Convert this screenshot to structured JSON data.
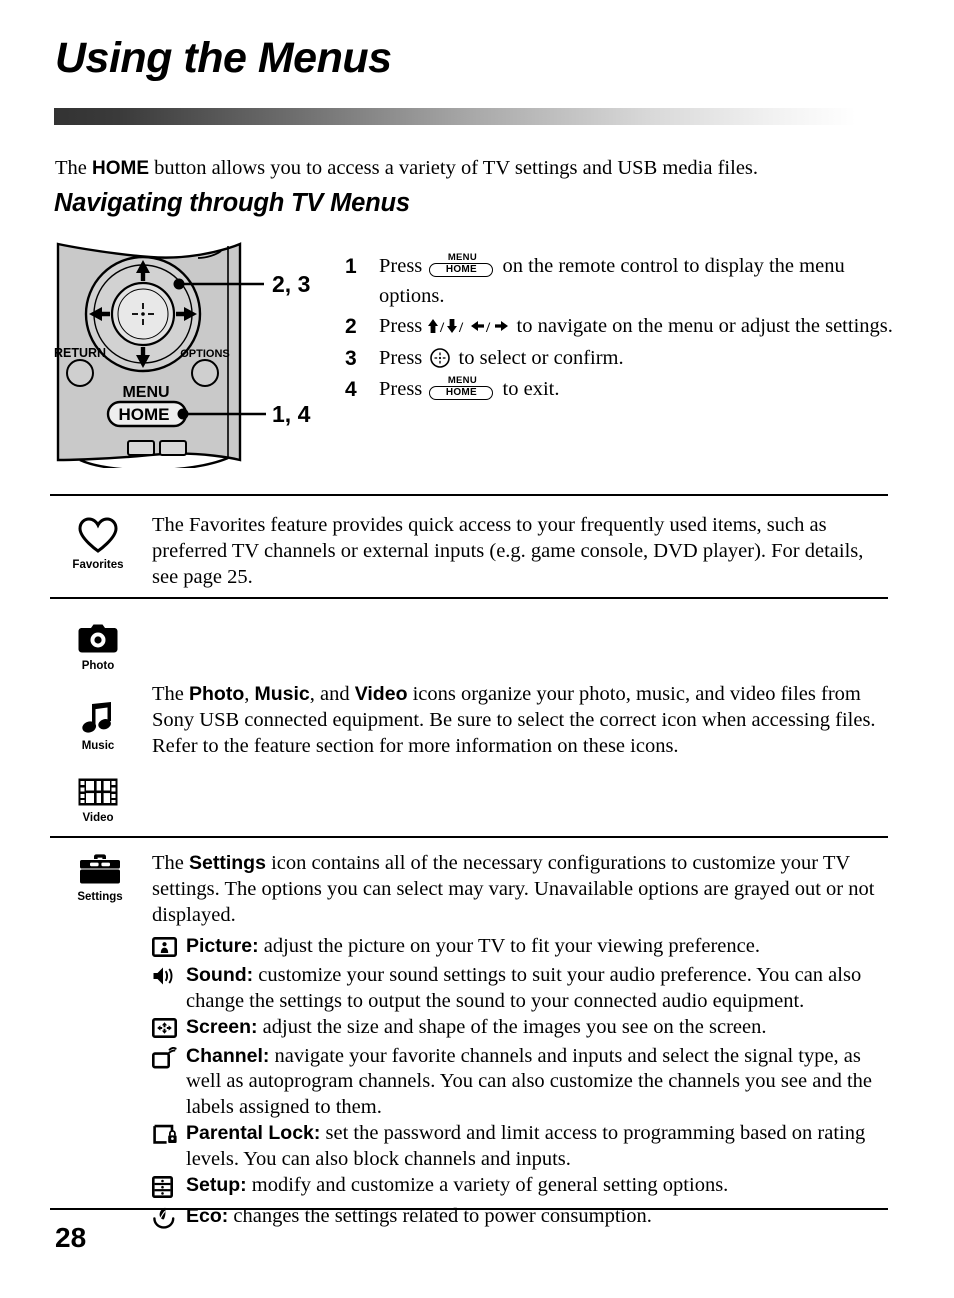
{
  "document": {
    "title": "Using the Menus",
    "page_number": "28",
    "intro_prefix": "The ",
    "intro_bold": "HOME",
    "intro_suffix": " button allows you to access a variety of TV settings and USB media files.",
    "section_title": "Navigating through TV Menus"
  },
  "remote": {
    "label_return": "RETURN",
    "label_options": "OPTIONS",
    "label_menu": "MENU",
    "label_home": "HOME",
    "callout_upper": "2, 3",
    "callout_lower": "1, 4"
  },
  "steps": [
    {
      "num": "1",
      "before": "Press ",
      "key": {
        "top": "MENU",
        "bottom": "HOME"
      },
      "after": " on the remote control to display the menu options."
    },
    {
      "num": "2",
      "before": "Press ",
      "arrows": "⬆/⬇/⬅/➡",
      "after": " to navigate on the menu or adjust the settings."
    },
    {
      "num": "3",
      "before": "Press ",
      "key_confirm": "confirm-button-icon",
      "after": " to select or confirm."
    },
    {
      "num": "4",
      "before": "Press ",
      "key": {
        "top": "MENU",
        "bottom": "HOME"
      },
      "after": " to exit."
    }
  ],
  "blocks": {
    "favorites": {
      "icon_label": "Favorites",
      "icon_name": "heart-icon",
      "text": "The Favorites feature provides quick access to your frequently used items, such as preferred TV channels or external inputs (e.g. game console, DVD player). For details, see page 25."
    },
    "media": {
      "icons": [
        {
          "label": "Photo",
          "icon_name": "camera-icon"
        },
        {
          "label": "Music",
          "icon_name": "music-note-icon"
        },
        {
          "label": "Video",
          "icon_name": "film-strip-icon"
        }
      ],
      "text_part1": "The ",
      "bold1": "Photo",
      "text_part2": ", ",
      "bold2": "Music",
      "text_part3": ", and ",
      "bold3": "Video",
      "text_part4": " icons organize your photo, music, and video files from Sony USB connected equipment. Be sure to select the correct icon when accessing files. Refer to the feature section for more information on these icons."
    },
    "settings": {
      "icon_label": "Settings",
      "icon_name": "toolbox-icon",
      "text_prefix": "The ",
      "text_bold": "Settings",
      "text_suffix": " icon contains all of the necessary configurations to customize your TV settings. The options you can select may vary. Unavailable options are grayed out or not displayed."
    }
  },
  "settings_items": [
    {
      "icon_name": "picture-icon",
      "label": "Picture:",
      "description": " adjust the picture on your TV to fit your viewing preference."
    },
    {
      "icon_name": "speaker-icon",
      "label": "Sound:",
      "description": " customize your sound settings to suit your audio preference. You can also change the settings to output the sound to your connected audio equipment."
    },
    {
      "icon_name": "screen-resize-icon",
      "label": "Screen:",
      "description": " adjust the size and shape of the images you see on the screen."
    },
    {
      "icon_name": "channel-icon",
      "label": "Channel:",
      "description": " navigate your favorite channels and inputs and select the signal type, as well as autoprogram channels. You can also customize the channels you see and the labels assigned to them."
    },
    {
      "icon_name": "parental-lock-icon",
      "label": "Parental Lock:",
      "description": " set the password and limit access to programming based on rating levels. You can also block channels and inputs."
    },
    {
      "icon_name": "setup-drawers-icon",
      "label": "Setup:",
      "description": " modify and customize a variety of general setting options."
    },
    {
      "icon_name": "eco-leaf-icon",
      "label": "Eco:",
      "description": " changes the settings related to power consumption."
    }
  ],
  "colors": {
    "ink": "#000000",
    "rule_dark": "#333333",
    "remote_body": "#c9c9c9",
    "remote_ring": "#d5d5d5"
  }
}
